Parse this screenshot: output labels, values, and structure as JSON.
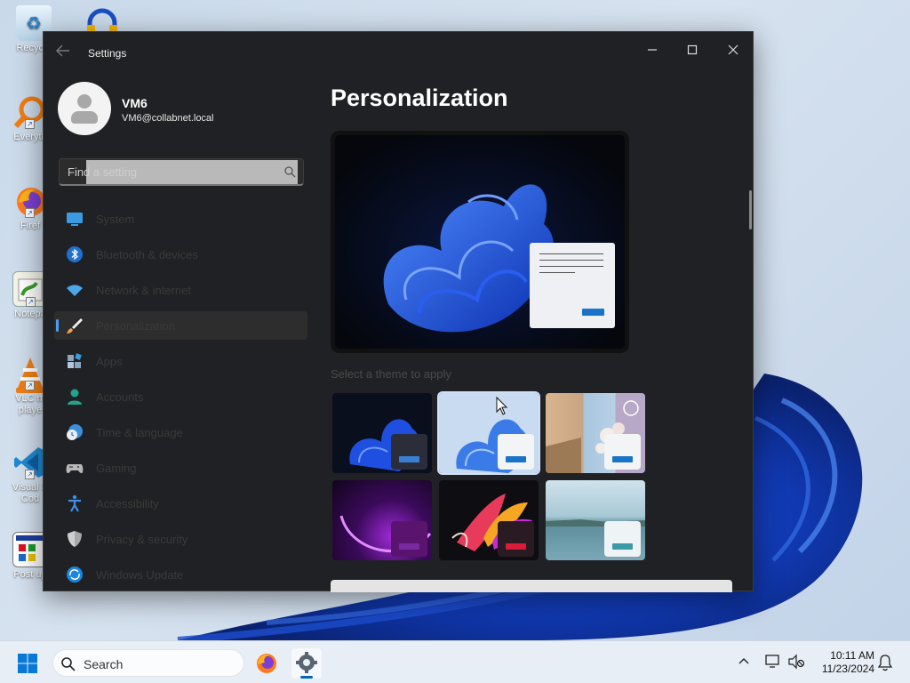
{
  "desktop": {
    "icons": [
      {
        "label": "Recycle",
        "icon": "recycle-bin-icon"
      },
      {
        "label": "Everyth",
        "icon": "everything-search-icon"
      },
      {
        "label": "Firef",
        "icon": "firefox-icon"
      },
      {
        "label": "Notepa",
        "icon": "notepad-plus-plus-icon"
      },
      {
        "label": "VLC m\nplaye",
        "icon": "vlc-icon"
      },
      {
        "label": "Visual S\nCod",
        "icon": "vscode-icon"
      },
      {
        "label": "Post up",
        "icon": "post-update-icon"
      }
    ]
  },
  "window": {
    "title": "Settings",
    "controls": {
      "minimize": "—",
      "maximize": "▢",
      "close": "✕"
    }
  },
  "user": {
    "name": "VM6",
    "email": "VM6@collabnet.local"
  },
  "search": {
    "placeholder": "Find a setting"
  },
  "nav": {
    "items": [
      {
        "label": "System",
        "icon": "system-display-icon",
        "color": "#3a9be0"
      },
      {
        "label": "Bluetooth & devices",
        "icon": "bluetooth-icon",
        "color": "#1f6fd0"
      },
      {
        "label": "Network & internet",
        "icon": "wifi-icon",
        "color": "#4aa8e8"
      },
      {
        "label": "Personalization",
        "icon": "paintbrush-icon",
        "color": "#e8a25a",
        "selected": true
      },
      {
        "label": "Apps",
        "icon": "apps-icon",
        "color": "#8da6c0"
      },
      {
        "label": "Accounts",
        "icon": "accounts-icon",
        "color": "#23a38c"
      },
      {
        "label": "Time & language",
        "icon": "time-language-icon",
        "color": "#3b8fd6"
      },
      {
        "label": "Gaming",
        "icon": "gaming-controller-icon",
        "color": "#b8b8b8"
      },
      {
        "label": "Accessibility",
        "icon": "accessibility-icon",
        "color": "#3f8fe6"
      },
      {
        "label": "Privacy & security",
        "icon": "shield-icon",
        "color": "#a8a8a8"
      },
      {
        "label": "Windows Update",
        "icon": "windows-update-icon",
        "color": "#1a86e0"
      }
    ]
  },
  "content": {
    "title": "Personalization",
    "themes_label": "Select a theme to apply",
    "themes": [
      {
        "name": "windows-dark",
        "selected": false
      },
      {
        "name": "windows-light",
        "selected": true
      },
      {
        "name": "windows-spotlight",
        "selected": false
      },
      {
        "name": "glow",
        "selected": false
      },
      {
        "name": "captured-motion",
        "selected": false
      },
      {
        "name": "flow",
        "selected": false
      }
    ]
  },
  "taskbar": {
    "search_text": "Search",
    "clock_time": "10:11 AM",
    "clock_date": "11/23/2024"
  },
  "colors": {
    "accent": "#0067c0",
    "window_bg": "#202124",
    "selection_pill": "#4c9cf0"
  }
}
